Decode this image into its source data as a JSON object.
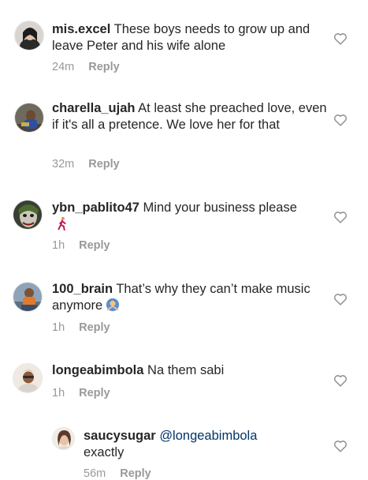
{
  "comments": [
    {
      "username": "mis.excel",
      "text": "These boys needs to grow up and leave Peter and his wife alone",
      "time": "24m",
      "reply": "Reply"
    },
    {
      "username": "charella_ujah",
      "text": "At least she preached love, even if it's all a pretence. We love her for that",
      "time": "32m",
      "reply": "Reply"
    },
    {
      "username": "ybn_pablito47",
      "text": "Mind your business please",
      "emoji": "walking-person-emoji",
      "time": "1h",
      "reply": "Reply"
    },
    {
      "username": "100_brain",
      "text": "That’s why they can’t make music anymore",
      "emoji": "person-gesturing-no-emoji",
      "time": "1h",
      "reply": "Reply"
    },
    {
      "username": "longeabimbola",
      "text": "Na them sabi",
      "time": "1h",
      "reply": "Reply"
    }
  ],
  "reply_thread": {
    "username": "saucysugar",
    "mention": "@longeabimbola",
    "text": "exactly",
    "time": "56m",
    "reply": "Reply"
  },
  "colors": {
    "text": "#262626",
    "meta": "#999999",
    "mention": "#003569",
    "heart_outline": "#8e8e8e"
  }
}
